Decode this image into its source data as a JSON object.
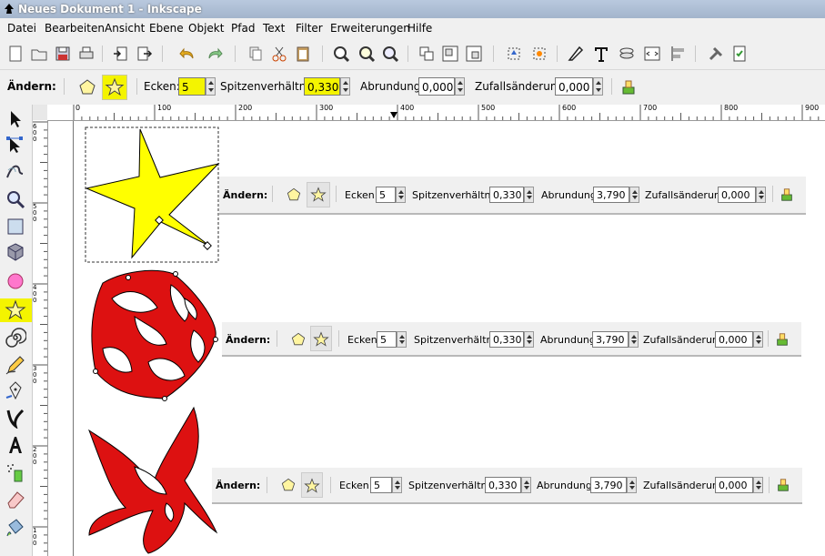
{
  "window": {
    "title": "Neues Dokument 1 - Inkscape"
  },
  "menu": [
    "Datei",
    "Bearbeiten",
    "Ansicht",
    "Ebene",
    "Objekt",
    "Pfad",
    "Text",
    "Filter",
    "Erweiterungen",
    "Hilfe"
  ],
  "controls": {
    "change_label": "Ändern:",
    "corners_label": "Ecken:",
    "corners_value": "5",
    "spoke_label": "Spitzenverhältnis:",
    "spoke_value": "0,330",
    "rounding_label": "Abrundung:",
    "rounding_value": "0,000",
    "random_label": "Zufallsänderung:",
    "random_value": "0,000"
  },
  "embedded_bars": [
    {
      "change_label": "Ändern:",
      "corners_label": "Ecken:",
      "corners_value": "5",
      "spoke_label": "Spitzenverhältnis:",
      "spoke_value": "0,330",
      "rounding_label": "Abrundung:",
      "rounding_value": "3,790",
      "random_label": "Zufallsänderung:",
      "random_value": "0,000"
    },
    {
      "change_label": "Ändern:",
      "corners_label": "Ecken:",
      "corners_value": "5",
      "spoke_label": "Spitzenverhältnis:",
      "spoke_value": "0,330",
      "rounding_label": "Abrundung:",
      "rounding_value": "3,790",
      "random_label": "Zufallsänderung:",
      "random_value": "0,000"
    },
    {
      "change_label": "Ändern:",
      "corners_label": "Ecken:",
      "corners_value": "5",
      "spoke_label": "Spitzenverhältnis:",
      "spoke_value": "0,330",
      "rounding_label": "Abrundung:",
      "rounding_value": "3,790",
      "random_label": "Zufallsänderung:",
      "random_value": "0,000"
    }
  ],
  "ruler": {
    "h_ticks": [
      "0",
      "100",
      "200",
      "300",
      "400",
      "500",
      "600",
      "700",
      "800",
      "900"
    ],
    "v_ticks": [
      "600",
      "500",
      "400",
      "300",
      "200",
      "100"
    ]
  },
  "colors": {
    "star_fill": "#ffff00",
    "shape_fill": "#dd1111",
    "highlight": "#f4f400",
    "titlebar": "#a3b5cc"
  },
  "icons": {
    "tools": [
      "selector-arrow-icon",
      "node-editor-icon",
      "tweak-icon",
      "zoom-icon",
      "rectangle-icon",
      "3d-box-icon",
      "ellipse-icon",
      "star-icon",
      "spiral-icon",
      "pencil-icon",
      "pen-icon",
      "calligraphy-icon",
      "text-icon",
      "spray-icon",
      "eraser-icon",
      "paint-bucket-icon"
    ]
  }
}
